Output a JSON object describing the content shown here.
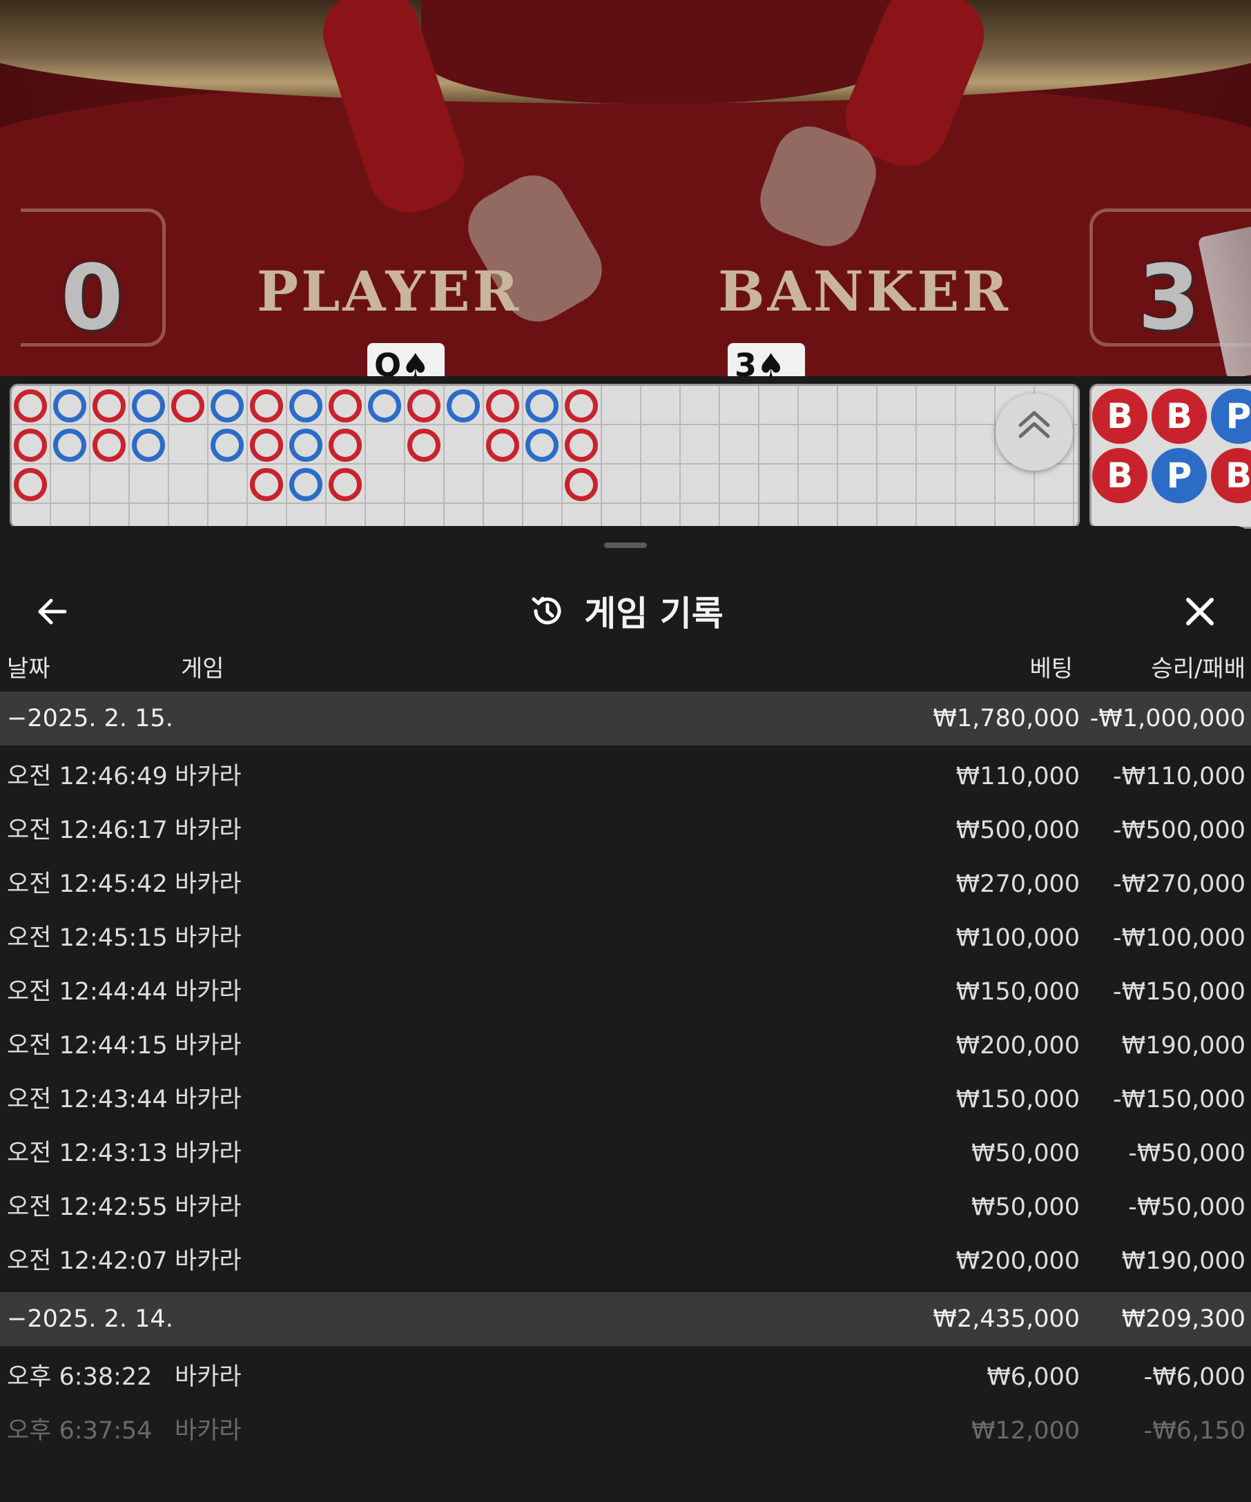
{
  "video": {
    "player_label": "PLAYER",
    "banker_label": "BANKER",
    "player_score": "0",
    "banker_score": "3",
    "player_card": "Q♠",
    "banker_card": "3♠"
  },
  "roadmap": {
    "big_road": [
      {
        "col": 0,
        "row": 0,
        "r": "B"
      },
      {
        "col": 0,
        "row": 1,
        "r": "B"
      },
      {
        "col": 0,
        "row": 2,
        "r": "B"
      },
      {
        "col": 1,
        "row": 0,
        "r": "P"
      },
      {
        "col": 1,
        "row": 1,
        "r": "P"
      },
      {
        "col": 2,
        "row": 0,
        "r": "B"
      },
      {
        "col": 2,
        "row": 1,
        "r": "B"
      },
      {
        "col": 3,
        "row": 0,
        "r": "P"
      },
      {
        "col": 3,
        "row": 1,
        "r": "P"
      },
      {
        "col": 4,
        "row": 0,
        "r": "B"
      },
      {
        "col": 5,
        "row": 0,
        "r": "P"
      },
      {
        "col": 5,
        "row": 1,
        "r": "P"
      },
      {
        "col": 6,
        "row": 0,
        "r": "B"
      },
      {
        "col": 6,
        "row": 1,
        "r": "B"
      },
      {
        "col": 6,
        "row": 2,
        "r": "B"
      },
      {
        "col": 7,
        "row": 0,
        "r": "P"
      },
      {
        "col": 7,
        "row": 1,
        "r": "P"
      },
      {
        "col": 7,
        "row": 2,
        "r": "P"
      },
      {
        "col": 8,
        "row": 0,
        "r": "B"
      },
      {
        "col": 8,
        "row": 1,
        "r": "B"
      },
      {
        "col": 8,
        "row": 2,
        "r": "B"
      },
      {
        "col": 9,
        "row": 0,
        "r": "P"
      },
      {
        "col": 10,
        "row": 0,
        "r": "B"
      },
      {
        "col": 10,
        "row": 1,
        "r": "B"
      },
      {
        "col": 11,
        "row": 0,
        "r": "P"
      },
      {
        "col": 12,
        "row": 0,
        "r": "B"
      },
      {
        "col": 12,
        "row": 1,
        "r": "B"
      },
      {
        "col": 13,
        "row": 0,
        "r": "P"
      },
      {
        "col": 13,
        "row": 1,
        "r": "P"
      },
      {
        "col": 14,
        "row": 0,
        "r": "B"
      },
      {
        "col": 14,
        "row": 1,
        "r": "B"
      },
      {
        "col": 14,
        "row": 2,
        "r": "B"
      }
    ],
    "bead_road": [
      {
        "col": 0,
        "row": 0,
        "r": "B"
      },
      {
        "col": 1,
        "row": 0,
        "r": "B"
      },
      {
        "col": 2,
        "row": 0,
        "r": "P"
      },
      {
        "col": 0,
        "row": 1,
        "r": "B"
      },
      {
        "col": 1,
        "row": 1,
        "r": "P"
      },
      {
        "col": 2,
        "row": 1,
        "r": "B"
      }
    ]
  },
  "sheet": {
    "title": "게임 기록",
    "columns": {
      "date": "날짜",
      "game": "게임",
      "bet": "베팅",
      "result": "승리/패배"
    }
  },
  "groups": [
    {
      "date": "−2025. 2. 15.",
      "bet": "₩1,780,000",
      "result": "-₩1,000,000",
      "rows": [
        {
          "time": "오전 12:46:49",
          "game": "바카라",
          "bet": "₩110,000",
          "result": "-₩110,000"
        },
        {
          "time": "오전 12:46:17",
          "game": "바카라",
          "bet": "₩500,000",
          "result": "-₩500,000"
        },
        {
          "time": "오전 12:45:42",
          "game": "바카라",
          "bet": "₩270,000",
          "result": "-₩270,000"
        },
        {
          "time": "오전 12:45:15",
          "game": "바카라",
          "bet": "₩100,000",
          "result": "-₩100,000"
        },
        {
          "time": "오전 12:44:44",
          "game": "바카라",
          "bet": "₩150,000",
          "result": "-₩150,000"
        },
        {
          "time": "오전 12:44:15",
          "game": "바카라",
          "bet": "₩200,000",
          "result": "₩190,000"
        },
        {
          "time": "오전 12:43:44",
          "game": "바카라",
          "bet": "₩150,000",
          "result": "-₩150,000"
        },
        {
          "time": "오전 12:43:13",
          "game": "바카라",
          "bet": "₩50,000",
          "result": "-₩50,000"
        },
        {
          "time": "오전 12:42:55",
          "game": "바카라",
          "bet": "₩50,000",
          "result": "-₩50,000"
        },
        {
          "time": "오전 12:42:07",
          "game": "바카라",
          "bet": "₩200,000",
          "result": "₩190,000"
        }
      ]
    },
    {
      "date": "−2025. 2. 14.",
      "bet": "₩2,435,000",
      "result": "₩209,300",
      "rows": [
        {
          "time": "오후 6:38:22",
          "game": "바카라",
          "bet": "₩6,000",
          "result": "-₩6,000"
        },
        {
          "time": "오후 6:37:54",
          "game": "바카라",
          "bet": "₩12,000",
          "result": "-₩6,150",
          "faded": true
        }
      ]
    }
  ]
}
